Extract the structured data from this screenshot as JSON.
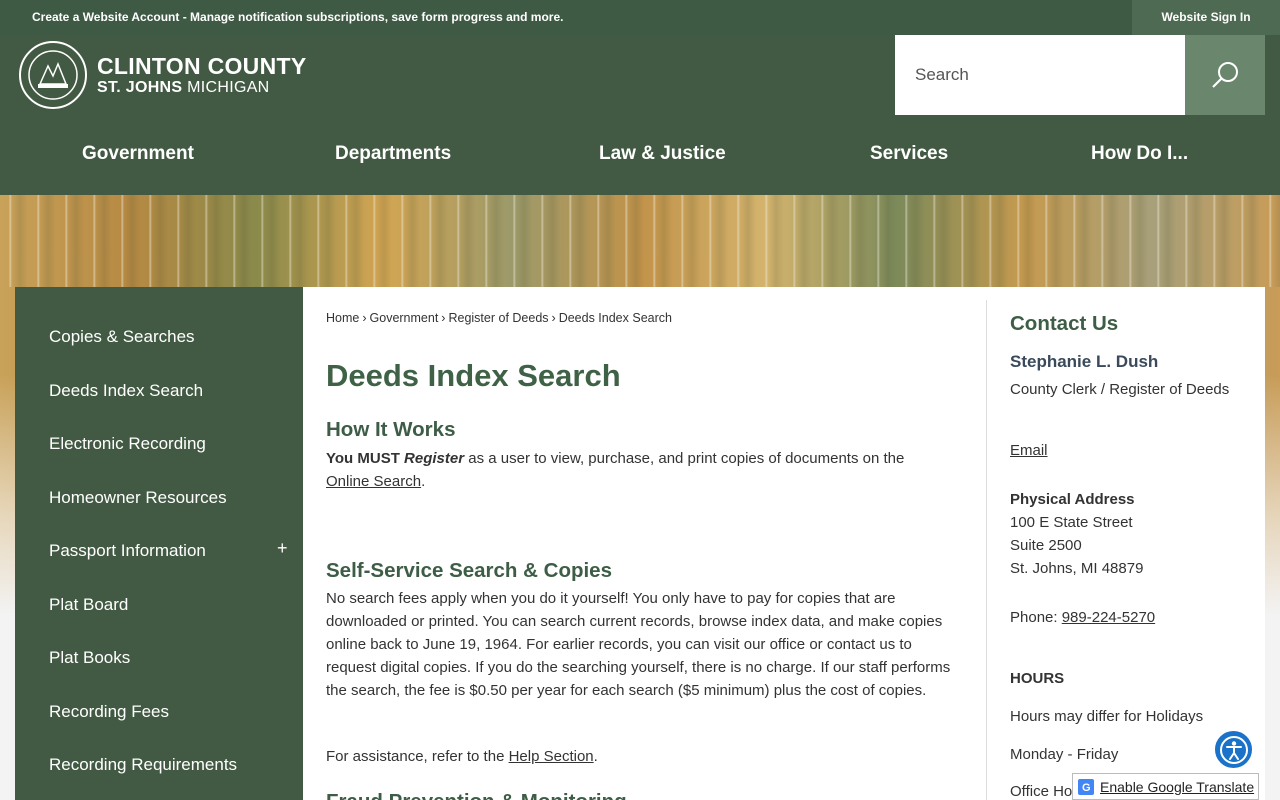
{
  "topbar": {
    "account_link": "Create a Website Account",
    "account_desc": " - Manage notification subscriptions, save form progress and more.",
    "signin": "Website Sign In"
  },
  "header": {
    "brand_line1": "CLINTON COUNTY",
    "brand_line2_bold": "ST. JOHNS",
    "brand_line2_rest": " MICHIGAN",
    "search_placeholder": "Search"
  },
  "nav": {
    "items": [
      "Government",
      "Departments",
      "Law & Justice",
      "Services",
      "How Do I..."
    ]
  },
  "sidebar": {
    "items": [
      "Copies & Searches",
      "Deeds Index Search",
      "Electronic Recording",
      "Homeowner Resources",
      "Passport Information",
      "Plat Board",
      "Plat Books",
      "Recording Fees",
      "Recording Requirements"
    ],
    "expand_symbol": "+"
  },
  "breadcrumb": {
    "items": [
      "Home",
      "Government",
      "Register of Deeds",
      "Deeds Index Search"
    ],
    "separator": "›"
  },
  "main": {
    "title": "Deeds Index Search",
    "how_heading": "How It Works",
    "how_must": "You MUST ",
    "how_register": "Register",
    "how_rest": " as a user to view, purchase, and print copies of documents on the",
    "how_link": "Online Search",
    "how_end": ".",
    "self_heading": "Self-Service Search & Copies",
    "self_text": "No search fees apply when you do it yourself! You only have to pay for copies that are downloaded or printed. You can search current records, browse index data, and make copies online back to June 19, 1964. For earlier records, you can visit our office or contact us to request digital copies. If you do the searching yourself, there is no charge. If our staff performs the search, the fee is $0.50 per year for each search ($5 minimum) plus the cost of copies.",
    "assist_prefix": "For assistance, refer to the ",
    "assist_link": "Help Section",
    "assist_end": ".",
    "fraud_heading": "Fraud Prevention & Monitoring"
  },
  "contact": {
    "title": "Contact Us",
    "name": "Stephanie L. Dush",
    "role": "County Clerk / Register of Deeds",
    "email": "Email",
    "address_label": "Physical Address",
    "address_line1": "100 E State Street",
    "address_line2": "Suite 2500",
    "address_line3": "St. Johns, MI 48879",
    "phone_label": "Phone: ",
    "phone": "989-224-5270",
    "hours_heading": "HOURS",
    "hours_note": "Hours may differ for Holidays",
    "days": "Monday - Friday",
    "office_hours": "Office Ho"
  },
  "widgets": {
    "translate_label": "Enable Google Translate"
  },
  "colors": {
    "brand_green": "#425a43",
    "heading_green": "#3e5d46",
    "accessibility_blue": "#1a73c8"
  }
}
